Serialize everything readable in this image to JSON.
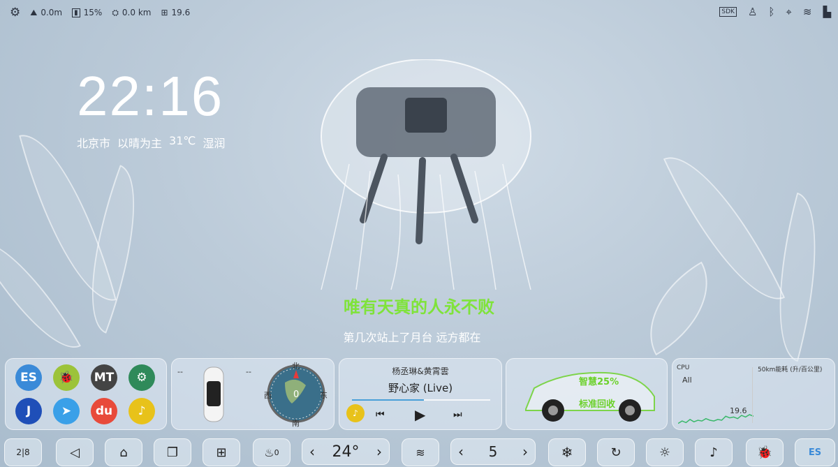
{
  "status": {
    "altitude": "0.0m",
    "battery": "15%",
    "trip": "0.0 km",
    "cpu": "19.6",
    "sdk_label": "SDK"
  },
  "clock": {
    "time": "22:16"
  },
  "weather": {
    "city": "北京市",
    "condition": "以晴为主",
    "temp": "31℃",
    "humidity": "湿润"
  },
  "lyrics": {
    "current": "唯有天真的人永不败",
    "next": "第几次站上了月台 远方都在"
  },
  "vehicle_card": {
    "left_dash": "--",
    "right_dash": "--",
    "compass_north": "北",
    "compass_value": "0",
    "compass_east": "东",
    "compass_west": "西",
    "compass_south": "南"
  },
  "music": {
    "artist": "杨丞琳&黄霄雲",
    "title": "野心家 (Live)",
    "progress": 0.52
  },
  "energy_card": {
    "mode": "智慧25%",
    "regen": "标准回收"
  },
  "monitor_card": {
    "cpu_label": "CPU",
    "scope": "All",
    "consumption_label": "50km能耗 (升/百公里)",
    "value": "19.6"
  },
  "apps": [
    {
      "name": "es-app",
      "label": "ES",
      "color": "#3a8ad8"
    },
    {
      "name": "bug-app",
      "label": "🐞",
      "color": "#9cc33a"
    },
    {
      "name": "mt-app",
      "label": "MT",
      "color": "#444"
    },
    {
      "name": "settings-app",
      "label": "⚙",
      "color": "#2f8a5a"
    },
    {
      "name": "j-app",
      "label": "J",
      "color": "#1f4fb8"
    },
    {
      "name": "nav-app",
      "label": "➤",
      "color": "#3aa0e8"
    },
    {
      "name": "du-app",
      "label": "du",
      "color": "#e84a3a"
    },
    {
      "name": "music-app",
      "label": "♪",
      "color": "#e8c21a"
    }
  ],
  "dock": {
    "temperature": "24°",
    "fan_speed": "5",
    "seat_level": "0"
  },
  "chart_data": {
    "type": "line",
    "title": "",
    "values": [
      3,
      6,
      4,
      8,
      5,
      7,
      6,
      9,
      7,
      6,
      8,
      7,
      12,
      10,
      11,
      9,
      13,
      11,
      14,
      12
    ]
  }
}
